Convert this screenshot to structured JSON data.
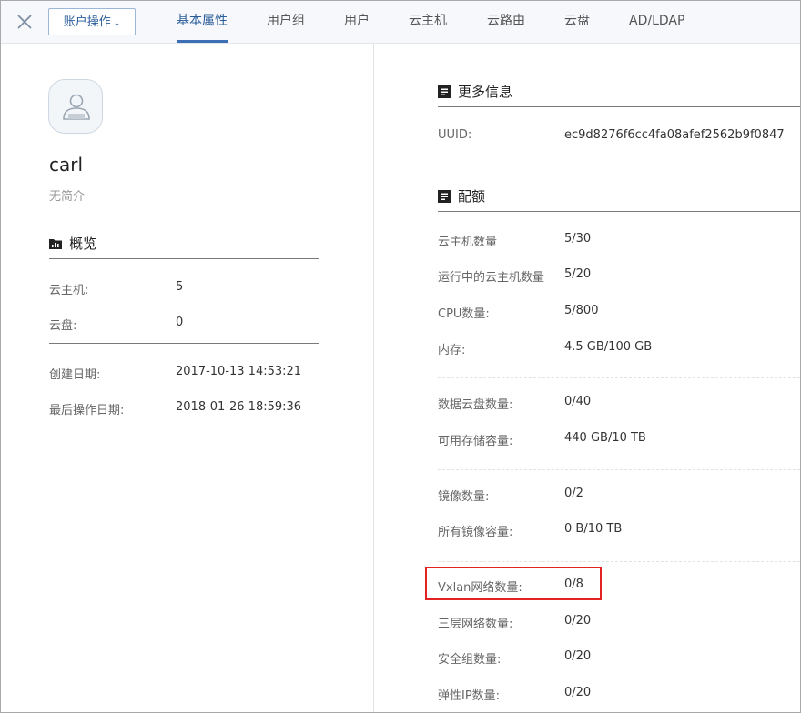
{
  "header": {
    "account_button": "账户操作",
    "tabs": [
      "基本属性",
      "用户组",
      "用户",
      "云主机",
      "云路由",
      "云盘",
      "AD/LDAP"
    ],
    "active_tab": 0
  },
  "profile": {
    "name": "carl",
    "bio": "无简介"
  },
  "overview": {
    "title": "概览",
    "rows": [
      {
        "label": "云主机:",
        "value": "5"
      },
      {
        "label": "云盘:",
        "value": "0"
      },
      {
        "label": "创建日期:",
        "value": "2017-10-13 14:53:21"
      },
      {
        "label": "最后操作日期:",
        "value": "2018-01-26 18:59:36"
      }
    ]
  },
  "more_info": {
    "title": "更多信息",
    "uuid_label": "UUID:",
    "uuid_value": "ec9d8276f6cc4fa08afef2562b9f0847"
  },
  "quota": {
    "title": "配额",
    "rows": [
      {
        "label": "云主机数量",
        "value": "5/30"
      },
      {
        "label": "运行中的云主机数量",
        "value": "5/20"
      },
      {
        "label": "CPU数量:",
        "value": "5/800"
      },
      {
        "label": "内存:",
        "value": "4.5 GB/100 GB"
      },
      {
        "label": "数据云盘数量:",
        "value": "0/40"
      },
      {
        "label": "可用存储容量:",
        "value": "440 GB/10 TB"
      },
      {
        "label": "镜像数量:",
        "value": "0/2"
      },
      {
        "label": "所有镜像容量:",
        "value": "0 B/10 TB"
      },
      {
        "label": "Vxlan网络数量:",
        "value": "0/8"
      },
      {
        "label": "三层网络数量:",
        "value": "0/20"
      },
      {
        "label": "安全组数量:",
        "value": "0/20"
      },
      {
        "label": "弹性IP数量:",
        "value": "0/20"
      }
    ]
  }
}
